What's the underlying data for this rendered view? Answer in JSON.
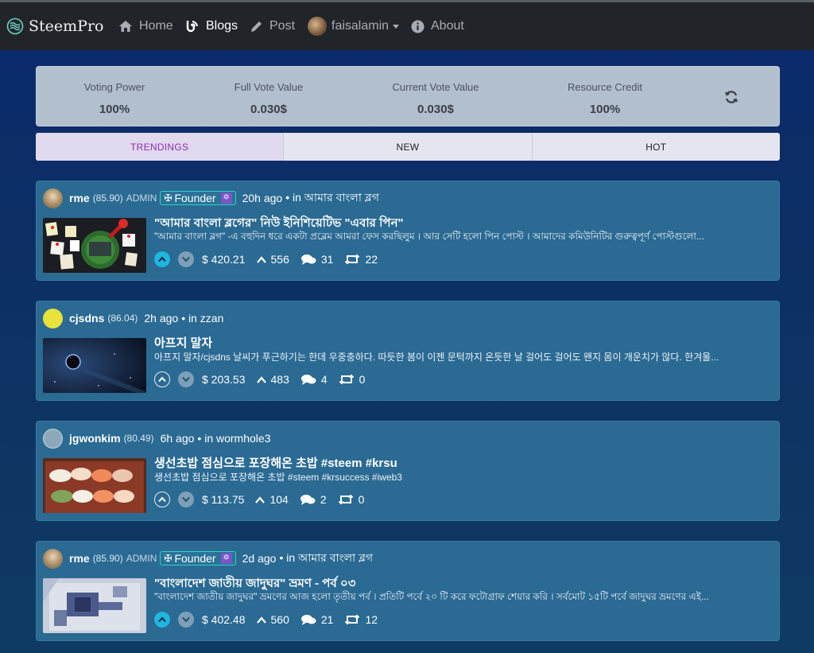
{
  "nav": {
    "brand": "SteemPro",
    "items": [
      {
        "label": "Home",
        "icon": "home-icon"
      },
      {
        "label": "Blogs",
        "icon": "blog-icon"
      },
      {
        "label": "Post",
        "icon": "pencil-icon"
      },
      {
        "label": "faisalamin",
        "icon": "avatar"
      },
      {
        "label": "About",
        "icon": "info-icon"
      }
    ]
  },
  "stats": [
    {
      "label": "Voting Power",
      "value": "100%"
    },
    {
      "label": "Full Vote Value",
      "value": "0.030$"
    },
    {
      "label": "Current Vote Value",
      "value": "0.030$"
    },
    {
      "label": "Resource Credit",
      "value": "100%"
    }
  ],
  "tabs": [
    "TRENDINGS",
    "NEW",
    "HOT"
  ],
  "posts": [
    {
      "author": "rme",
      "rep": "(85.90)",
      "role": "ADMIN",
      "badge": "Founder",
      "time": "20h ago",
      "community": "• in আমার বাংলা ব্লগ",
      "title": "\"আমার বাংলা ব্লগের\" নিউ ইনিশিয়েটিভ \"এবার পিন\"",
      "body": "\"আমার বাংলা ব্লগ\" -এ বহুদিন ধরে একটা প্রব্লেম আমরা ফেস করছিলুম । আর সেটি হলো পিন পোস্ট । আমাদের কমিউনিটির গুরুত্বপূর্ণ পোস্টগুলো...",
      "payout": "$ 420.21",
      "votes": "556",
      "comments": "31",
      "resteems": "22",
      "upvoted": true
    },
    {
      "author": "cjsdns",
      "rep": "(86.04)",
      "role": "",
      "badge": "",
      "time": "2h ago",
      "community": "• in zzan",
      "title": "아프지 말자",
      "body": "아프지 말자/cjsdns 날씨가 푸근하기는 한데 우중충하다. 따듯한 봄이 이젠 문턱까지 온듯한 날 걸어도 걸어도 왠지 몸이 개운치가 않다. 한겨울...",
      "payout": "$ 203.53",
      "votes": "483",
      "comments": "4",
      "resteems": "0",
      "upvoted": false
    },
    {
      "author": "jgwonkim",
      "rep": "(80.49)",
      "role": "",
      "badge": "",
      "time": "6h ago",
      "community": "• in wormhole3",
      "title": "생선초밥 점심으로 포장해온 초밥 #steem #krsu",
      "body": "생선초밥 점심으로 포장해온 초밥 #steem #krsuccess #iweb3",
      "payout": "$ 113.75",
      "votes": "104",
      "comments": "2",
      "resteems": "0",
      "upvoted": false
    },
    {
      "author": "rme",
      "rep": "(85.90)",
      "role": "ADMIN",
      "badge": "Founder",
      "time": "2d ago",
      "community": "• in আমার বাংলা ব্লগ",
      "title": "\"বাংলাদেশ জাতীয় জাদুঘর\" ভ্রমণ - পর্ব ০৩",
      "body": "\"বাংলাদেশ জাতীয় জাদুঘর\" ভ্রমণের আজ হলো তৃতীয় পর্ব । প্রতিটি পর্বে ২০ টি করে ফটোগ্রাফ শেয়ার করি । সর্বমোট ১৫টি পর্বে জাদুঘর ভ্রমণের এই...",
      "payout": "$ 402.48",
      "votes": "560",
      "comments": "21",
      "resteems": "12",
      "upvoted": true
    }
  ]
}
